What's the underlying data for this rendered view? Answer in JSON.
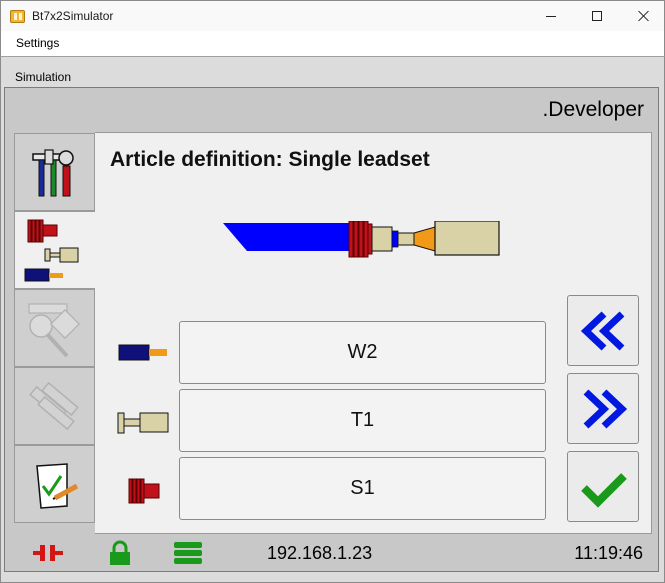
{
  "window": {
    "title": "Bt7x2Simulator",
    "icon": "folder-app-icon",
    "controls": [
      "minimize-icon",
      "maximize-icon",
      "close-icon"
    ]
  },
  "menu": {
    "items": [
      "Settings"
    ]
  },
  "simulation": {
    "label": "Simulation",
    "user": ".Developer",
    "title": "Article definition: Single leadset",
    "nav": [
      {
        "name": "tools-icon",
        "active": false
      },
      {
        "name": "leadset-parts-icon",
        "active": true
      },
      {
        "name": "measure-icon",
        "active": false
      },
      {
        "name": "rollers-icon",
        "active": false
      },
      {
        "name": "checklist-icon",
        "active": false
      }
    ],
    "rows": [
      {
        "icon": "wire-icon",
        "value": "W2"
      },
      {
        "icon": "terminal-icon",
        "value": "T1"
      },
      {
        "icon": "seal-icon",
        "value": "S1"
      }
    ],
    "side_buttons": [
      "double-chevron-left-icon",
      "double-chevron-right-icon",
      "checkmark-icon"
    ],
    "status": {
      "ip": "192.168.1.23",
      "time": "11:19:46",
      "icons": [
        "disconnected-plug-icon",
        "lock-icon",
        "database-icon"
      ]
    }
  },
  "colors": {
    "wire_blue": "#0000ff",
    "seal_red": "#c0121a",
    "terminal_tan": "#d8d2a6",
    "accent_blue": "#0018e0",
    "ok_green": "#1a9a1a"
  }
}
